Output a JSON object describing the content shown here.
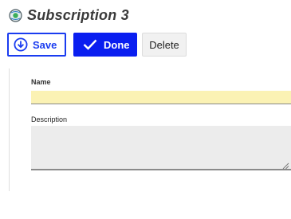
{
  "header": {
    "title": "Subscription 3",
    "icon": "subscription-globe-icon"
  },
  "toolbar": {
    "save_label": "Save",
    "save_icon": "download-circle-icon",
    "done_label": "Done",
    "done_icon": "checkmark-icon",
    "delete_label": "Delete"
  },
  "form": {
    "name_label": "Name",
    "name_value": "",
    "description_label": "Description",
    "description_value": ""
  },
  "colors": {
    "accent": "#1a3cf0",
    "done_bg": "#0a1ef0",
    "name_field_bg": "#fbf2b4",
    "textarea_bg": "#ececec"
  }
}
